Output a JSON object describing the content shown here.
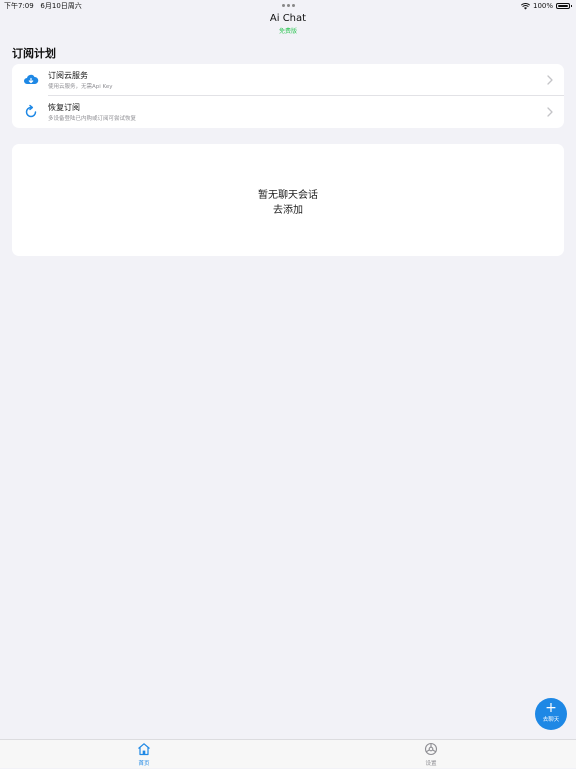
{
  "status_bar": {
    "time": "下午7:09",
    "date": "6月10日周六",
    "battery": "100%",
    "battery_level": 1.0
  },
  "nav": {
    "title": "Ai Chat",
    "subtitle": "免费版"
  },
  "subscription": {
    "section_title": "订阅计划",
    "items": [
      {
        "icon": "cloud-download-icon",
        "title": "订阅云服务",
        "desc": "使用云服务，无需Api Key"
      },
      {
        "icon": "refresh-icon",
        "title": "恢复订阅",
        "desc": "多设备登陆已内购或订阅可尝试恢复"
      }
    ]
  },
  "chat_list": {
    "empty_title": "暂无聊天会话",
    "empty_action": "去添加"
  },
  "fab": {
    "icon": "plus-icon",
    "label": "去聊天"
  },
  "tab_bar": {
    "tabs": [
      {
        "icon": "home-icon",
        "label": "首页",
        "active": true
      },
      {
        "icon": "gear-icon",
        "label": "设置",
        "active": false
      }
    ]
  },
  "colors": {
    "accent": "#1e88e5",
    "subtitle": "#34c759",
    "background": "#f2f2f7"
  }
}
